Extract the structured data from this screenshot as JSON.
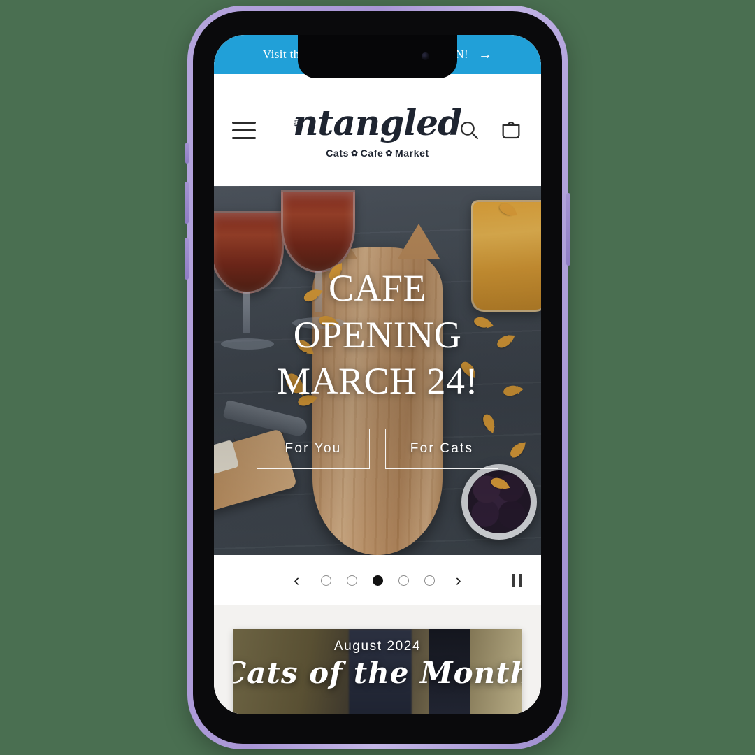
{
  "background_color": "#4a6f51",
  "device": {
    "frame_color": "#a996d6",
    "bezel_color": "#0a0a0c",
    "buttons": [
      {
        "name": "mute-switch"
      },
      {
        "name": "volume-up-button"
      },
      {
        "name": "volume-down-button"
      },
      {
        "name": "power-button"
      }
    ]
  },
  "announcement": {
    "text": "Visit the Cafe! Reservations now OPEN!",
    "arrow": "→",
    "background_color": "#21a0d8",
    "text_color": "#ffffff"
  },
  "header": {
    "menu_icon": "hamburger-icon",
    "logo": {
      "word": "ntangled",
      "tagline_parts": [
        "Cats",
        "Cafe",
        "Market"
      ],
      "paw_separator": "✿"
    },
    "icons": [
      {
        "name": "search-icon",
        "label": "Search"
      },
      {
        "name": "cart-icon",
        "label": "Cart"
      }
    ]
  },
  "hero": {
    "title_lines": [
      "CAFE",
      "OPENING",
      "MARCH 24!"
    ],
    "buttons": [
      {
        "label": "For You"
      },
      {
        "label": "For Cats"
      }
    ],
    "photo_description": "Cat-shaped wooden cutting board with rose wine glasses, goldfish crackers and blackberries on slate"
  },
  "carousel": {
    "prev_label": "‹",
    "next_label": "›",
    "slide_count": 5,
    "active_slide": 3,
    "pause_label": "Pause slideshow"
  },
  "feature": {
    "month": "August 2024",
    "heading": "Cats of the Month",
    "section_background": "#f3f2f0"
  }
}
